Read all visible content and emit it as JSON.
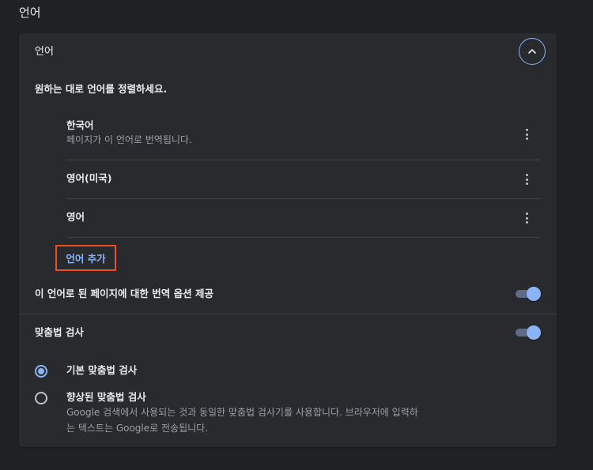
{
  "page": {
    "title": "언어"
  },
  "languages_section": {
    "label": "언어",
    "collapse_icon": "chevron-up-icon",
    "description": "원하는 대로 언어를 정렬하세요.",
    "items": [
      {
        "name": "한국어",
        "subtitle": "페이지가 이 언어로 번역됩니다."
      },
      {
        "name": "영어(미국)"
      },
      {
        "name": "영어"
      }
    ],
    "more_icon": "more-vert-icon",
    "add_button": "언어 추가"
  },
  "translate_offer": {
    "label": "이 언어로 된 페이지에 대한 번역 옵션 제공",
    "enabled": true
  },
  "spellcheck": {
    "label": "맞춤법 검사",
    "enabled": true,
    "options": [
      {
        "label": "기본 맞춤법 검사",
        "checked": true
      },
      {
        "label": "향상된 맞춤법 검사",
        "checked": false,
        "description_line1": "Google 검색에서 사용되는 것과 동일한 맞춤법 검사기를 사용합니다. 브라우저에 입력하",
        "description_line2": "는 텍스트는 Google로 전송됩니다."
      }
    ]
  },
  "colors": {
    "background": "#202124",
    "card": "#292a2d",
    "accent": "#8ab4f8",
    "highlight_border": "#e8501d",
    "divider": "#3c4043"
  }
}
